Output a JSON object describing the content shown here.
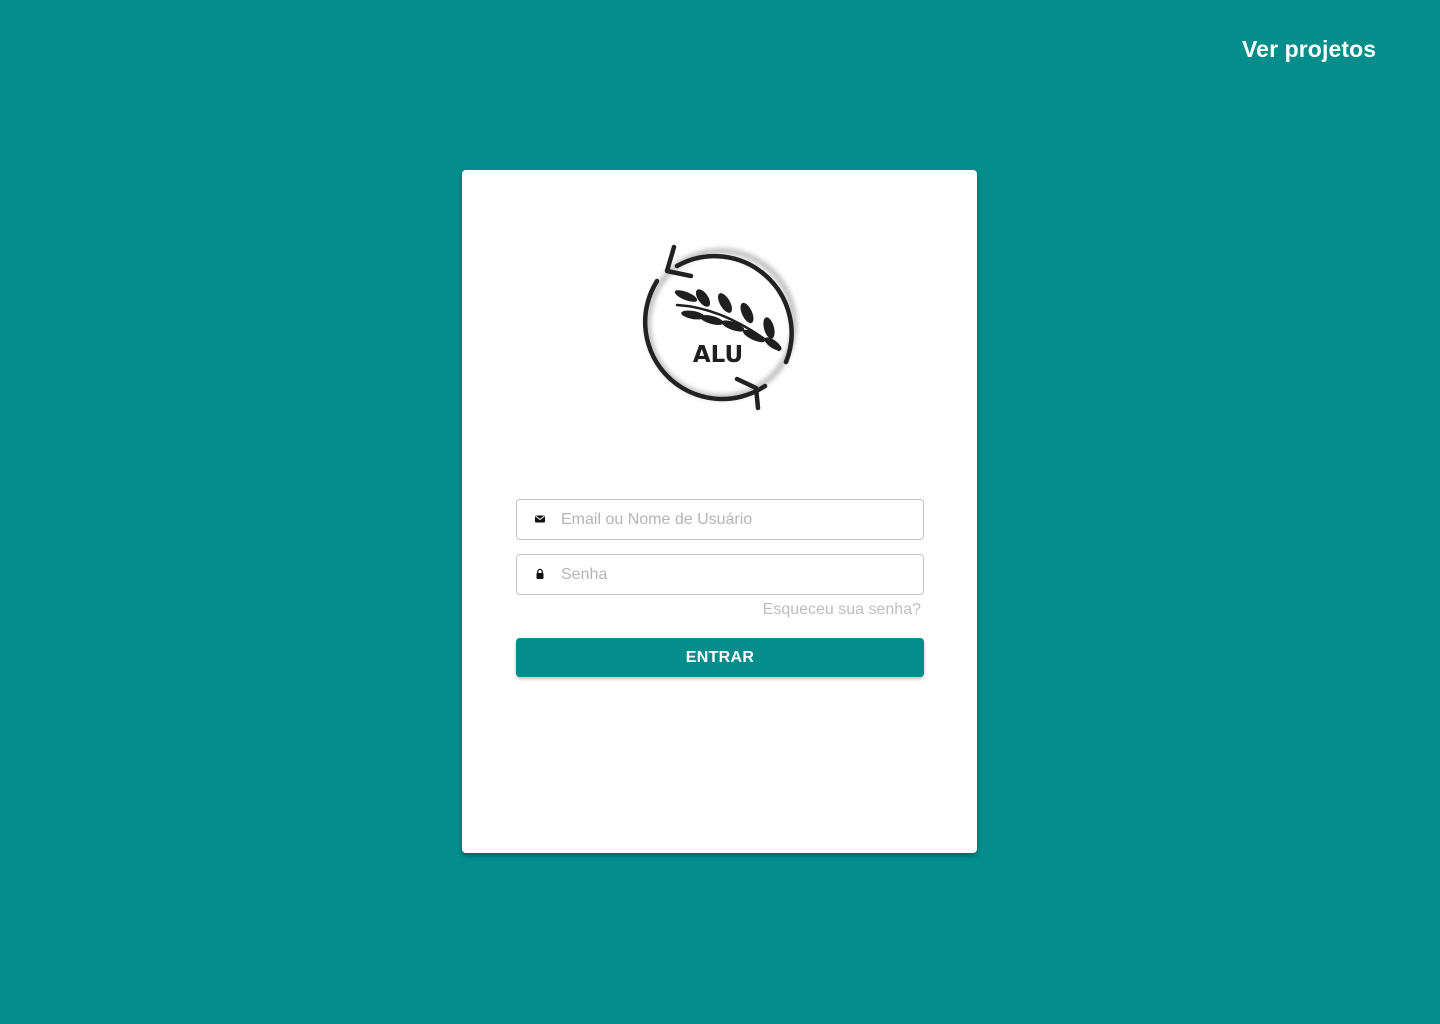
{
  "header": {
    "link_label": "Ver projetos"
  },
  "login": {
    "logo_text": "ALU",
    "email_placeholder": "Email ou Nome de Usuário",
    "password_placeholder": "Senha",
    "forgot_label": "Esqueceu sua senha?",
    "submit_label": "ENTRAR"
  },
  "icons": {
    "email": "envelope-icon",
    "password": "lock-icon",
    "logo": "recycle-arrows-leaf-logo"
  },
  "colors": {
    "background": "#038d8b",
    "card": "#ffffff",
    "button": "#038d8b",
    "button_text": "#ffffff",
    "placeholder": "#b5b5b5",
    "forgot_link": "#bdbdbd"
  }
}
